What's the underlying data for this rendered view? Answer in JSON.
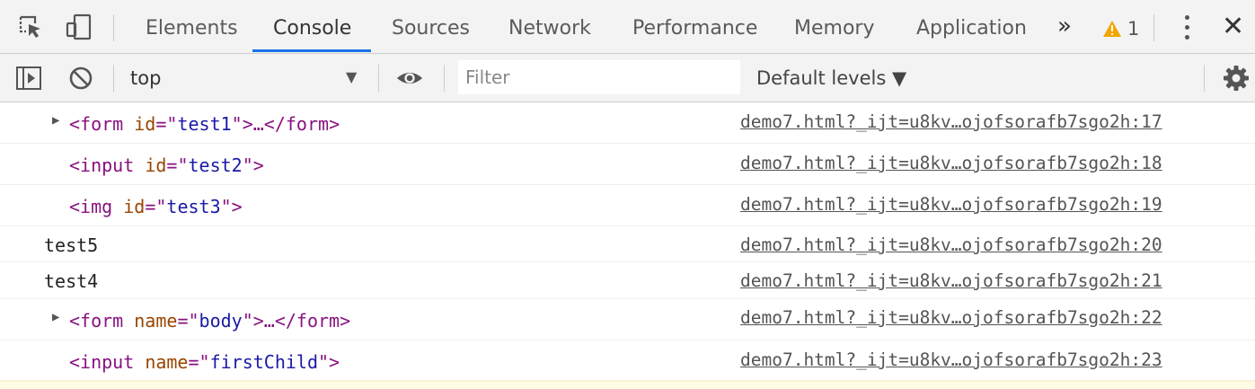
{
  "tabs": [
    {
      "label": "Elements"
    },
    {
      "label": "Console",
      "active": true
    },
    {
      "label": "Sources"
    },
    {
      "label": "Network"
    },
    {
      "label": "Performance"
    },
    {
      "label": "Memory"
    },
    {
      "label": "Application"
    }
  ],
  "more_tabs": "»",
  "warnings": {
    "count": "1",
    "icon": "warning-triangle-icon",
    "color": "#f2a600"
  },
  "close": "✕",
  "toolbar": {
    "context": "top",
    "filter_placeholder": "Filter",
    "levels": "Default levels ▼"
  },
  "colors": {
    "accent": "#1a73e8",
    "tag": "#881280",
    "attr_name": "#994500",
    "attr_value": "#1a1aa6"
  },
  "log": [
    {
      "expandable": true,
      "tag": "form",
      "attr": "id",
      "value": "test1",
      "tail": ">…</",
      "close_tag": "form",
      "source": "demo7.html?_ijt=u8kv…ojofsorafb7sgo2h:17"
    },
    {
      "expandable": false,
      "tag": "input",
      "attr": "id",
      "value": "test2",
      "source": "demo7.html?_ijt=u8kv…ojofsorafb7sgo2h:18"
    },
    {
      "expandable": false,
      "tag": "img",
      "attr": "id",
      "value": "test3",
      "source": "demo7.html?_ijt=u8kv…ojofsorafb7sgo2h:19"
    },
    {
      "text": "test5",
      "source": "demo7.html?_ijt=u8kv…ojofsorafb7sgo2h:20"
    },
    {
      "text": "test4",
      "source": "demo7.html?_ijt=u8kv…ojofsorafb7sgo2h:21"
    },
    {
      "expandable": true,
      "tag": "form",
      "attr": "name",
      "value": "body",
      "tail": ">…</",
      "close_tag": "form",
      "source": "demo7.html?_ijt=u8kv…ojofsorafb7sgo2h:22"
    },
    {
      "expandable": false,
      "tag": "input",
      "attr": "name",
      "value": "firstChild",
      "source": "demo7.html?_ijt=u8kv…ojofsorafb7sgo2h:23"
    }
  ]
}
